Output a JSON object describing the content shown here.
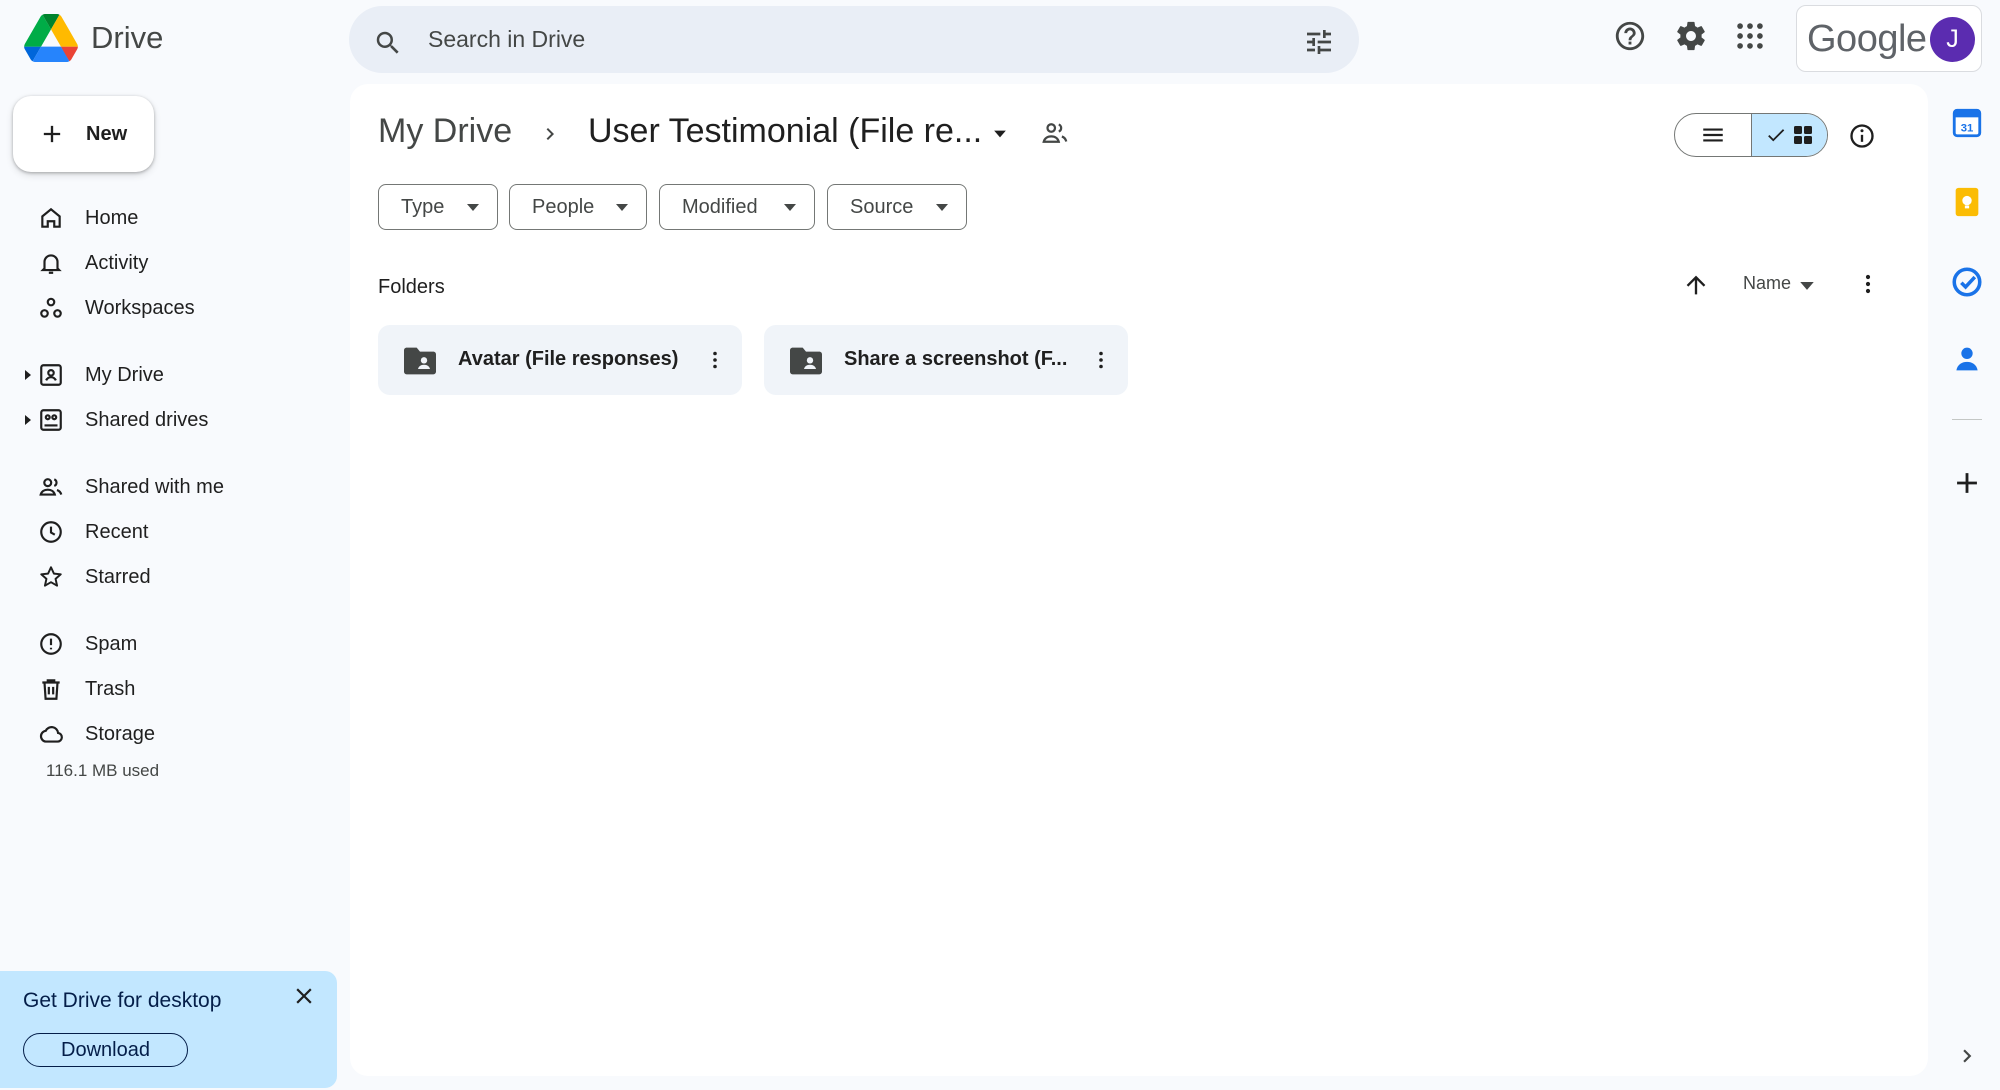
{
  "app": {
    "name": "Drive",
    "account_brand": "Google",
    "avatar_initial": "J"
  },
  "header": {
    "search_placeholder": "Search in Drive",
    "icons": [
      "search-icon",
      "tune-icon",
      "help-icon",
      "settings-icon",
      "apps-grid-icon"
    ]
  },
  "sidebar": {
    "new_label": "New",
    "items": [
      {
        "label": "Home",
        "icon": "home-icon"
      },
      {
        "label": "Activity",
        "icon": "bell-icon"
      },
      {
        "label": "Workspaces",
        "icon": "workspaces-icon"
      },
      {
        "label": "My Drive",
        "icon": "my-drive-icon",
        "expandable": true
      },
      {
        "label": "Shared drives",
        "icon": "shared-drives-icon",
        "expandable": true
      },
      {
        "label": "Shared with me",
        "icon": "people-icon"
      },
      {
        "label": "Recent",
        "icon": "clock-icon"
      },
      {
        "label": "Starred",
        "icon": "star-icon"
      },
      {
        "label": "Spam",
        "icon": "spam-icon"
      },
      {
        "label": "Trash",
        "icon": "trash-icon"
      },
      {
        "label": "Storage",
        "icon": "cloud-icon"
      }
    ],
    "storage_used": "116.1 MB used",
    "promo": {
      "title": "Get Drive for desktop",
      "button": "Download"
    }
  },
  "main": {
    "breadcrumb": {
      "root": "My Drive",
      "current": "User Testimonial (File re..."
    },
    "filters": [
      "Type",
      "People",
      "Modified",
      "Source"
    ],
    "section_label": "Folders",
    "sort": {
      "field": "Name",
      "direction": "ascending"
    },
    "view_mode": "grid",
    "folders": [
      {
        "name": "Avatar (File responses)"
      },
      {
        "name": "Share a screenshot (F..."
      }
    ]
  },
  "side_panel": {
    "apps": [
      "calendar-icon",
      "keep-icon",
      "tasks-icon",
      "contacts-icon"
    ],
    "calendar_day": "31",
    "colors": {
      "calendar": "#1a73e8",
      "keep": "#fbbc04",
      "tasks": "#1a73e8",
      "contacts": "#1a73e8"
    }
  },
  "colors": {
    "accent_selected": "#c2e7ff",
    "search_bg": "#e9eef6",
    "avatar": "#5b2cb0",
    "panel_bg": "#f8fafd"
  }
}
